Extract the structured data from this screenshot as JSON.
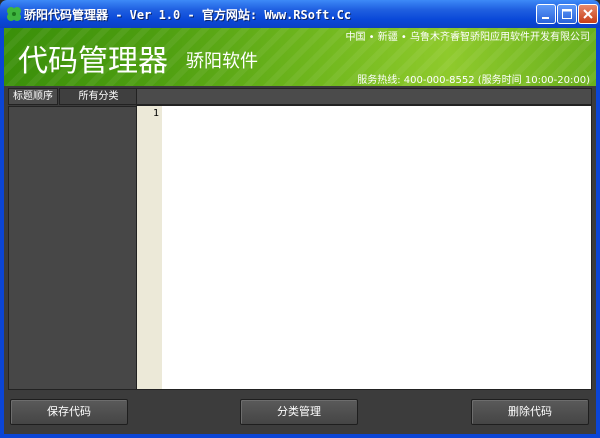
{
  "window": {
    "title": "骄阳代码管理器 - Ver 1.0 - 官方网站: Www.RSoft.Cc",
    "icon": "clover-icon"
  },
  "header": {
    "app_name": "代码管理器",
    "brand": "骄阳软件",
    "company": "中国 • 新疆 • 乌鲁木齐睿智骄阳应用软件开发有限公司",
    "hotline": "服务热线: 400-000-8552 (服务时间 10:00-20:00)"
  },
  "sidebar": {
    "tabs": [
      {
        "label": "标题顺序"
      },
      {
        "label": "所有分类"
      }
    ]
  },
  "editor": {
    "line_numbers": [
      "1"
    ]
  },
  "buttons": {
    "save": "保存代码",
    "category": "分类管理",
    "delete": "删除代码"
  },
  "colors": {
    "titlebar": "#0a48d8",
    "header_green": "#73b91f",
    "panel_dark": "#3c3c3c"
  }
}
